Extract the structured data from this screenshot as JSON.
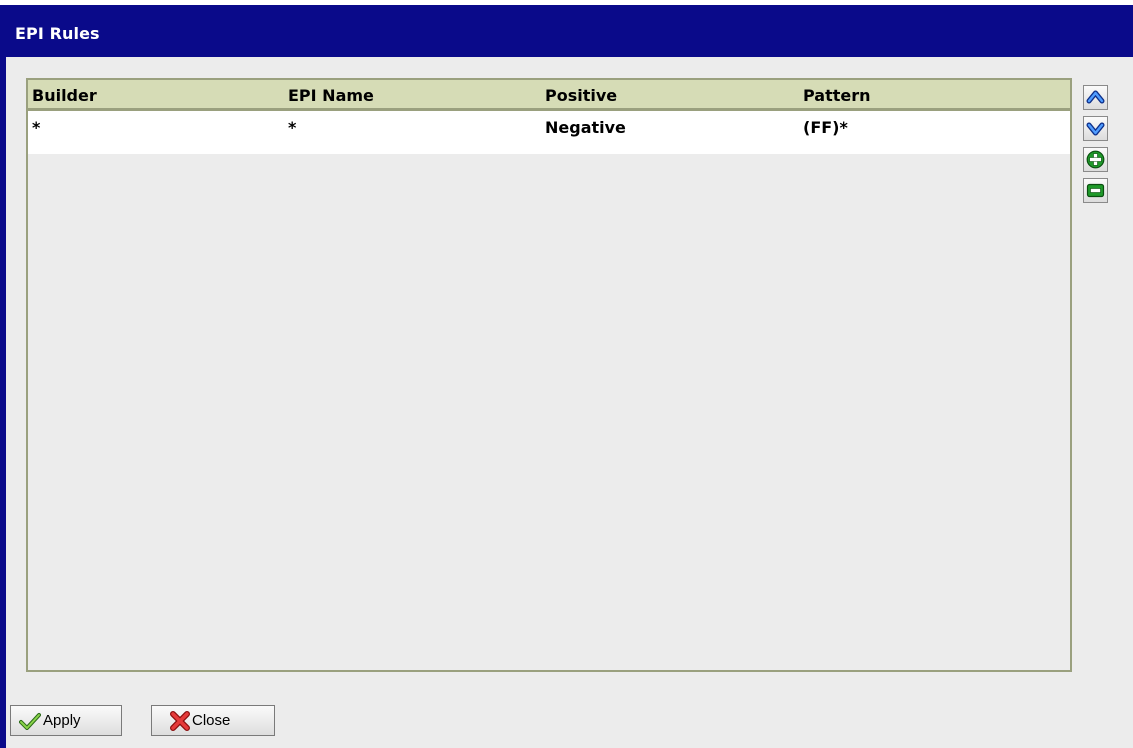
{
  "window": {
    "title": "EPI Rules"
  },
  "table": {
    "columns": [
      "Builder",
      "EPI Name",
      "Positive",
      "Pattern"
    ],
    "rows": [
      [
        "*",
        "*",
        "Negative",
        "(FF)*"
      ]
    ]
  },
  "side_buttons": {
    "icons": [
      "chevron-up-icon",
      "chevron-down-icon",
      "plus-icon",
      "minus-icon"
    ]
  },
  "buttons": {
    "apply_label": "Apply",
    "close_label": "Close"
  },
  "colors": {
    "titlebar": "#0a0a8a",
    "header_bg": "#d6dcb6",
    "header_border": "#9aa07e",
    "icon_blue": "#1e5fd8",
    "icon_green": "#1f9a2a",
    "icon_red": "#d42020"
  }
}
